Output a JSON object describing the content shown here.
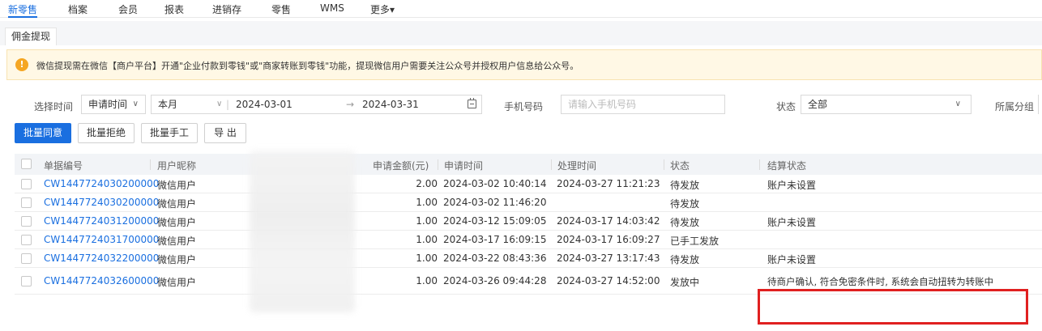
{
  "topnav": {
    "items": [
      "新零售",
      "档案",
      "会员",
      "报表",
      "进销存",
      "零售",
      "WMS",
      "更多▾"
    ],
    "active_index": 0
  },
  "tabs": {
    "current": "佣金提现"
  },
  "notice": {
    "icon": "warning-icon",
    "text": "微信提现需在微信【商户平台】开通\"企业付款到零钱\"或\"商家转账到零钱\"功能，提现微信用户需要关注公众号并授权用户信息给公众号。"
  },
  "filters": {
    "time_label": "选择时间",
    "time_type": "申请时间",
    "period": "本月",
    "date_start": "2024-03-01",
    "date_end": "2024-03-31",
    "phone_label": "手机号码",
    "phone_placeholder": "请输入手机号码",
    "status_label": "状态",
    "status_value": "全部",
    "group_label": "所属分组"
  },
  "actions": {
    "batch_approve": "批量同意",
    "batch_reject": "批量拒绝",
    "batch_manual": "批量手工",
    "export": "导 出"
  },
  "table": {
    "headers": [
      "单据编号",
      "用户昵称",
      "申请金额(元)",
      "申请时间",
      "处理时间",
      "状态",
      "结算状态"
    ],
    "rows": [
      {
        "id": "CW1447724030200000",
        "nickname": "微信用户",
        "amount": "2.00",
        "apply_time": "2024-03-02 10:40:14",
        "process_time": "2024-03-27 11:21:23",
        "status": "待发放",
        "settle_status": "账户未设置"
      },
      {
        "id": "CW1447724030200000",
        "nickname": "微信用户",
        "amount": "1.00",
        "apply_time": "2024-03-02 11:46:20",
        "process_time": "",
        "status": "待发放",
        "settle_status": ""
      },
      {
        "id": "CW1447724031200000",
        "nickname": "微信用户",
        "amount": "1.00",
        "apply_time": "2024-03-12 15:09:05",
        "process_time": "2024-03-17 14:03:42",
        "status": "待发放",
        "settle_status": "账户未设置"
      },
      {
        "id": "CW1447724031700000",
        "nickname": "微信用户",
        "amount": "1.00",
        "apply_time": "2024-03-17 16:09:15",
        "process_time": "2024-03-17 16:09:27",
        "status": "已手工发放",
        "settle_status": ""
      },
      {
        "id": "CW1447724032200000",
        "nickname": "微信用户",
        "amount": "1.00",
        "apply_time": "2024-03-22 08:43:36",
        "process_time": "2024-03-27 13:17:43",
        "status": "待发放",
        "settle_status": "账户未设置"
      },
      {
        "id": "CW1447724032600000",
        "nickname": "微信用户",
        "amount": "1.00",
        "apply_time": "2024-03-26 09:44:28",
        "process_time": "2024-03-27 14:52:00",
        "status": "发放中",
        "settle_status": "待商户确认, 符合免密条件时, 系统会自动扭转为转账中"
      }
    ]
  },
  "colors": {
    "accent": "#1a6fe0",
    "highlight": "#e02020",
    "notice_bg": "#fff8e5",
    "warning": "#f5a623"
  }
}
